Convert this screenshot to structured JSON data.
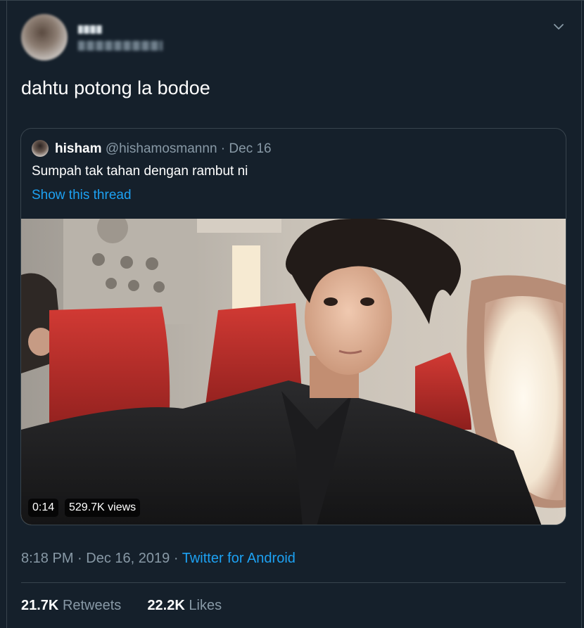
{
  "tweet": {
    "author_name": "",
    "author_handle": "",
    "text": "dahtu potong la bodoe",
    "time": "8:18 PM",
    "date": "Dec 16, 2019",
    "separator": "·",
    "source": "Twitter for Android",
    "menu_icon": "chevron-down-icon"
  },
  "quoted_tweet": {
    "name": "hisham",
    "handle": "@hishamosmannn",
    "separator": "·",
    "date": "Dec 16",
    "text": "Sumpah tak tahan dengan rambut ni",
    "show_thread_label": "Show this thread",
    "video": {
      "duration": "0:14",
      "views": "529.7K views"
    }
  },
  "stats": {
    "retweets_count": "21.7K",
    "retweets_label": "Retweets",
    "likes_count": "22.2K",
    "likes_label": "Likes"
  },
  "colors": {
    "background": "#15202b",
    "border": "#38444d",
    "text_primary": "#ffffff",
    "text_secondary": "#8899a6",
    "accent": "#1da1f2"
  }
}
